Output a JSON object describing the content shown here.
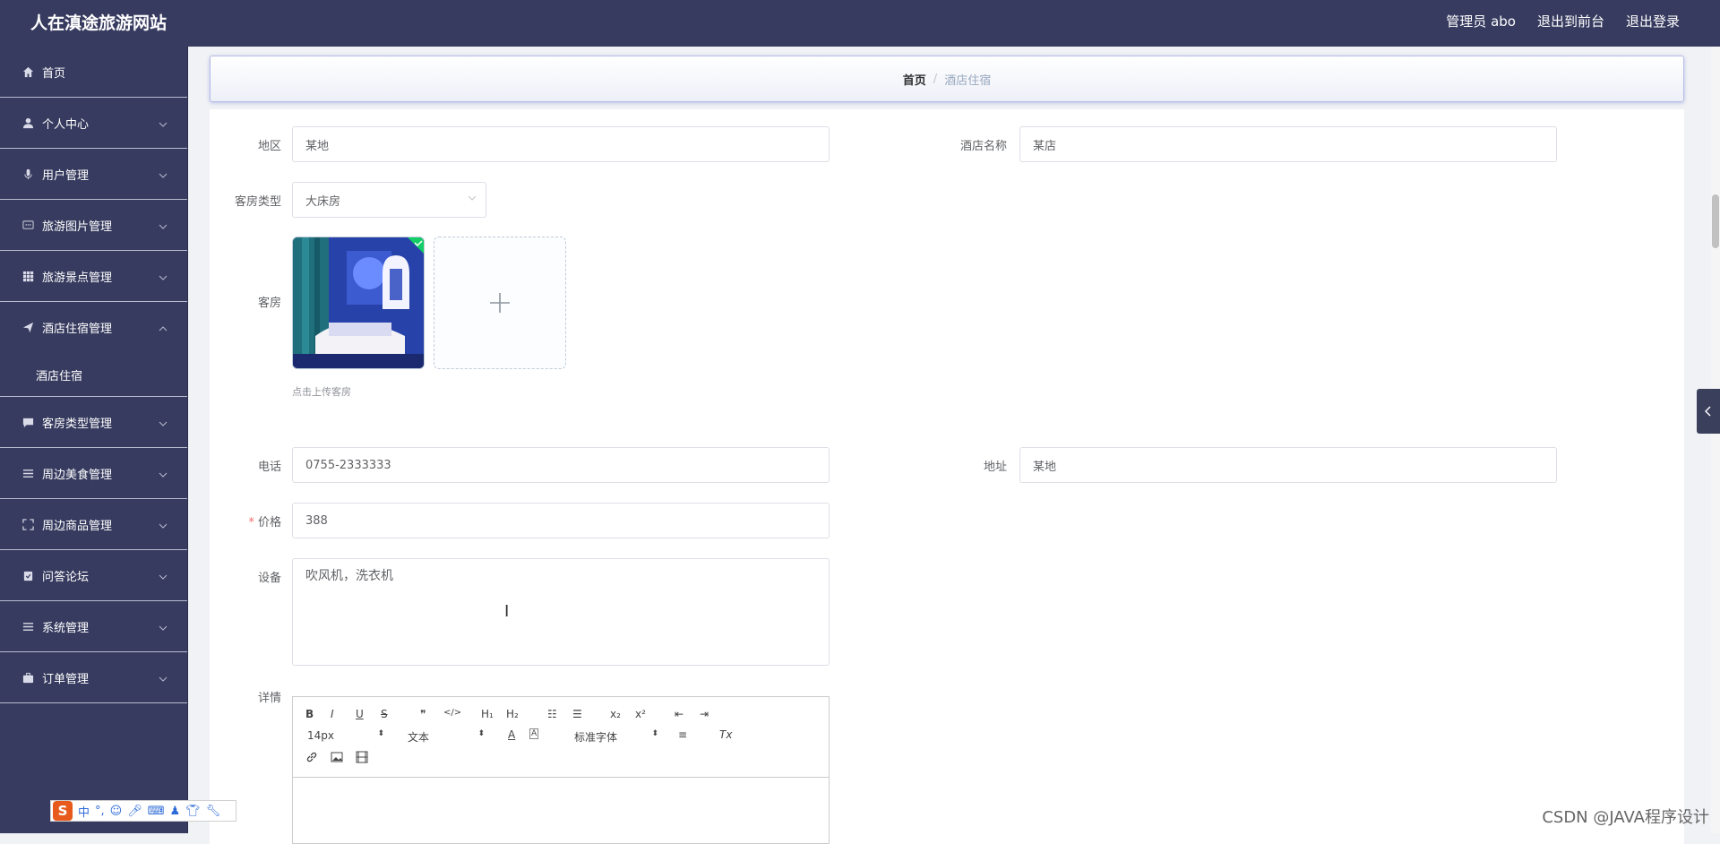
{
  "app": {
    "title": "人在滇途旅游网站"
  },
  "header": {
    "user_label": "管理员 abo",
    "front_label": "退出到前台",
    "logout_label": "退出登录"
  },
  "sidebar": {
    "items": [
      {
        "label": "首页",
        "icon": "home-icon"
      },
      {
        "label": "个人中心",
        "icon": "user-icon"
      },
      {
        "label": "用户管理",
        "icon": "microphone-icon"
      },
      {
        "label": "旅游图片管理",
        "icon": "chat-icon"
      },
      {
        "label": "旅游景点管理",
        "icon": "grid-icon"
      },
      {
        "label": "酒店住宿管理",
        "icon": "send-icon"
      },
      {
        "label": "客房类型管理",
        "icon": "message-icon"
      },
      {
        "label": "周边美食管理",
        "icon": "list-icon"
      },
      {
        "label": "周边商品管理",
        "icon": "fullscreen-icon"
      },
      {
        "label": "问答论坛",
        "icon": "checklist-icon"
      },
      {
        "label": "系统管理",
        "icon": "list-icon"
      },
      {
        "label": "订单管理",
        "icon": "briefcase-icon"
      }
    ],
    "submenu": {
      "label": "酒店住宿"
    }
  },
  "breadcrumb": {
    "home": "首页",
    "sep": "/",
    "current": "酒店住宿"
  },
  "form": {
    "region": {
      "label": "地区",
      "value": "某地"
    },
    "hotel_name": {
      "label": "酒店名称",
      "value": "某店"
    },
    "room_type": {
      "label": "客房类型",
      "value": "大床房"
    },
    "room": {
      "label": "客房",
      "hint": "点击上传客房"
    },
    "phone": {
      "label": "电话",
      "value": "0755-2333333"
    },
    "address": {
      "label": "地址",
      "value": "某地"
    },
    "price": {
      "label": "价格",
      "required": "*",
      "value": "388"
    },
    "facilities": {
      "label": "设备",
      "value": "吹风机，洗衣机"
    },
    "details": {
      "label": "详情"
    }
  },
  "editor": {
    "bold": "B",
    "italic": "I",
    "underline": "U",
    "strike": "S",
    "quote": "❞",
    "code": "</>",
    "h1": "H₁",
    "h2": "H₂",
    "ordered": "☷",
    "bullet": "☰",
    "sub": "x₂",
    "sup": "x²",
    "outdent": "⇤",
    "indent": "⇥",
    "size": "14px",
    "text": "文本",
    "font": "标准字体",
    "align": "≡",
    "clean": "Tx"
  },
  "ime": {
    "lang": "中",
    "punct": "°,"
  },
  "watermark": "CSDN @JAVA程序设计"
}
